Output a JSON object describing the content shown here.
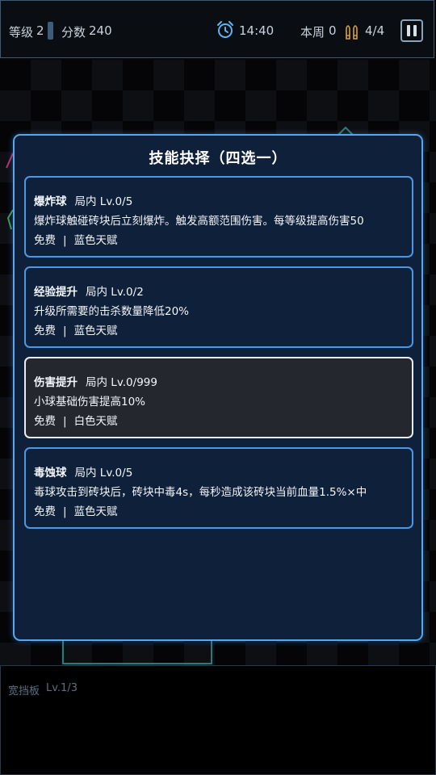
{
  "hud": {
    "level_label": "等级",
    "level_value": "2",
    "score_label": "分数",
    "score_value": "240",
    "timer": "14:40",
    "week_label": "本周",
    "week_value": "0",
    "ammo": "4/4",
    "alarm_icon": "alarm-clock-icon",
    "ammo_icon": "bullets-icon",
    "pause_icon": "pause-icon"
  },
  "modal": {
    "title": "技能抉择（四选一）",
    "cards": [
      {
        "name": "爆炸球",
        "scope": "局内",
        "level": "Lv.0/5",
        "desc": "爆炸球触碰砖块后立刻爆炸。触发高额范围伤害。每等级提高伤害50",
        "cost": "免费",
        "separator": "|",
        "rarity": "蓝色天赋",
        "rarity_color": "#4c98e4"
      },
      {
        "name": "经验提升",
        "scope": "局内",
        "level": "Lv.0/2",
        "desc": "升级所需要的击杀数量降低20%",
        "cost": "免费",
        "separator": "|",
        "rarity": "蓝色天赋",
        "rarity_color": "#4c98e4"
      },
      {
        "name": "伤害提升",
        "scope": "局内",
        "level": "Lv.0/999",
        "desc": "小球基础伤害提高10%",
        "cost": "免费",
        "separator": "|",
        "rarity": "白色天赋",
        "rarity_color": "#e9edf2"
      },
      {
        "name": "毒蚀球",
        "scope": "局内",
        "level": "Lv.0/5",
        "desc": "毒球攻击到砖块后，砖块中毒4s，每秒造成该砖块当前血量1.5%×中",
        "cost": "免费",
        "separator": "|",
        "rarity": "蓝色天赋",
        "rarity_color": "#4c98e4"
      }
    ]
  },
  "bottom_panel": {
    "paddle_name": "宽挡板",
    "paddle_level": "Lv.1/3"
  },
  "colors": {
    "modal_border": "#58a6ee",
    "modal_bg": "#0f203a",
    "blue_card_border": "#4c98e4",
    "white_card_border": "#e9edf2"
  }
}
